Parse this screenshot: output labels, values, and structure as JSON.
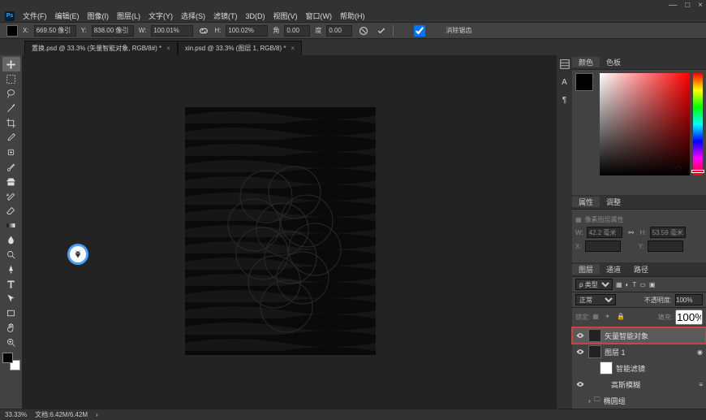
{
  "window": {
    "min": "—",
    "max": "□",
    "close": "×"
  },
  "menu": [
    "文件(F)",
    "编辑(E)",
    "图像(I)",
    "图层(L)",
    "文字(Y)",
    "选择(S)",
    "滤镜(T)",
    "3D(D)",
    "视图(V)",
    "窗口(W)",
    "帮助(H)"
  ],
  "options": {
    "x_label": "X:",
    "x_val": "669.50 像引",
    "y_label": "Y:",
    "y_val": "838.00 像引",
    "w_label": "W:",
    "w_val": "100.01%",
    "h_label": "H:",
    "h_val": "100.02%",
    "angle_label": "角",
    "angle_val": "0.00",
    "skew_val": "0.00",
    "interp_label": "消除锯齿"
  },
  "tabs": [
    {
      "label": "置换.psd @ 33.3% (矢量智能对象, RGB/8#) *"
    },
    {
      "label": "xin.psd @ 33.3% (图层 1, RGB/8) *"
    }
  ],
  "panels": {
    "color_tabs": [
      "颜色",
      "色板"
    ],
    "props_tabs": [
      "属性",
      "调整"
    ],
    "props_title": "像素图层属性",
    "props": {
      "w_label": "W:",
      "w_val": "42.2 毫米",
      "h_label": "H:",
      "h_val": "53.59 毫米",
      "x_label": "X:",
      "x_val": "",
      "y_label": "Y:",
      "y_val": ""
    },
    "layers_tabs": [
      "图层",
      "通道",
      "路径"
    ],
    "blend": "正常",
    "opacity_label": "不透明度:",
    "opacity": "100%",
    "lock_label": "锁定:",
    "fill_label": "填充:",
    "fill": "100%",
    "layers": [
      {
        "name": "矢量智能对象",
        "sel": true,
        "indent": 0,
        "mask": false
      },
      {
        "name": "图层 1",
        "sel": false,
        "indent": 0,
        "mask": false,
        "fx": true
      },
      {
        "name": "智能滤镜",
        "sel": false,
        "indent": 1,
        "mask": true
      },
      {
        "name": "高斯模糊",
        "sel": false,
        "indent": 2,
        "text": true
      },
      {
        "name": "椭圆组",
        "sel": false,
        "indent": 0,
        "group": true
      }
    ]
  },
  "status": {
    "zoom": "33.33%",
    "doc": "文档:6.42M/6.42M"
  }
}
